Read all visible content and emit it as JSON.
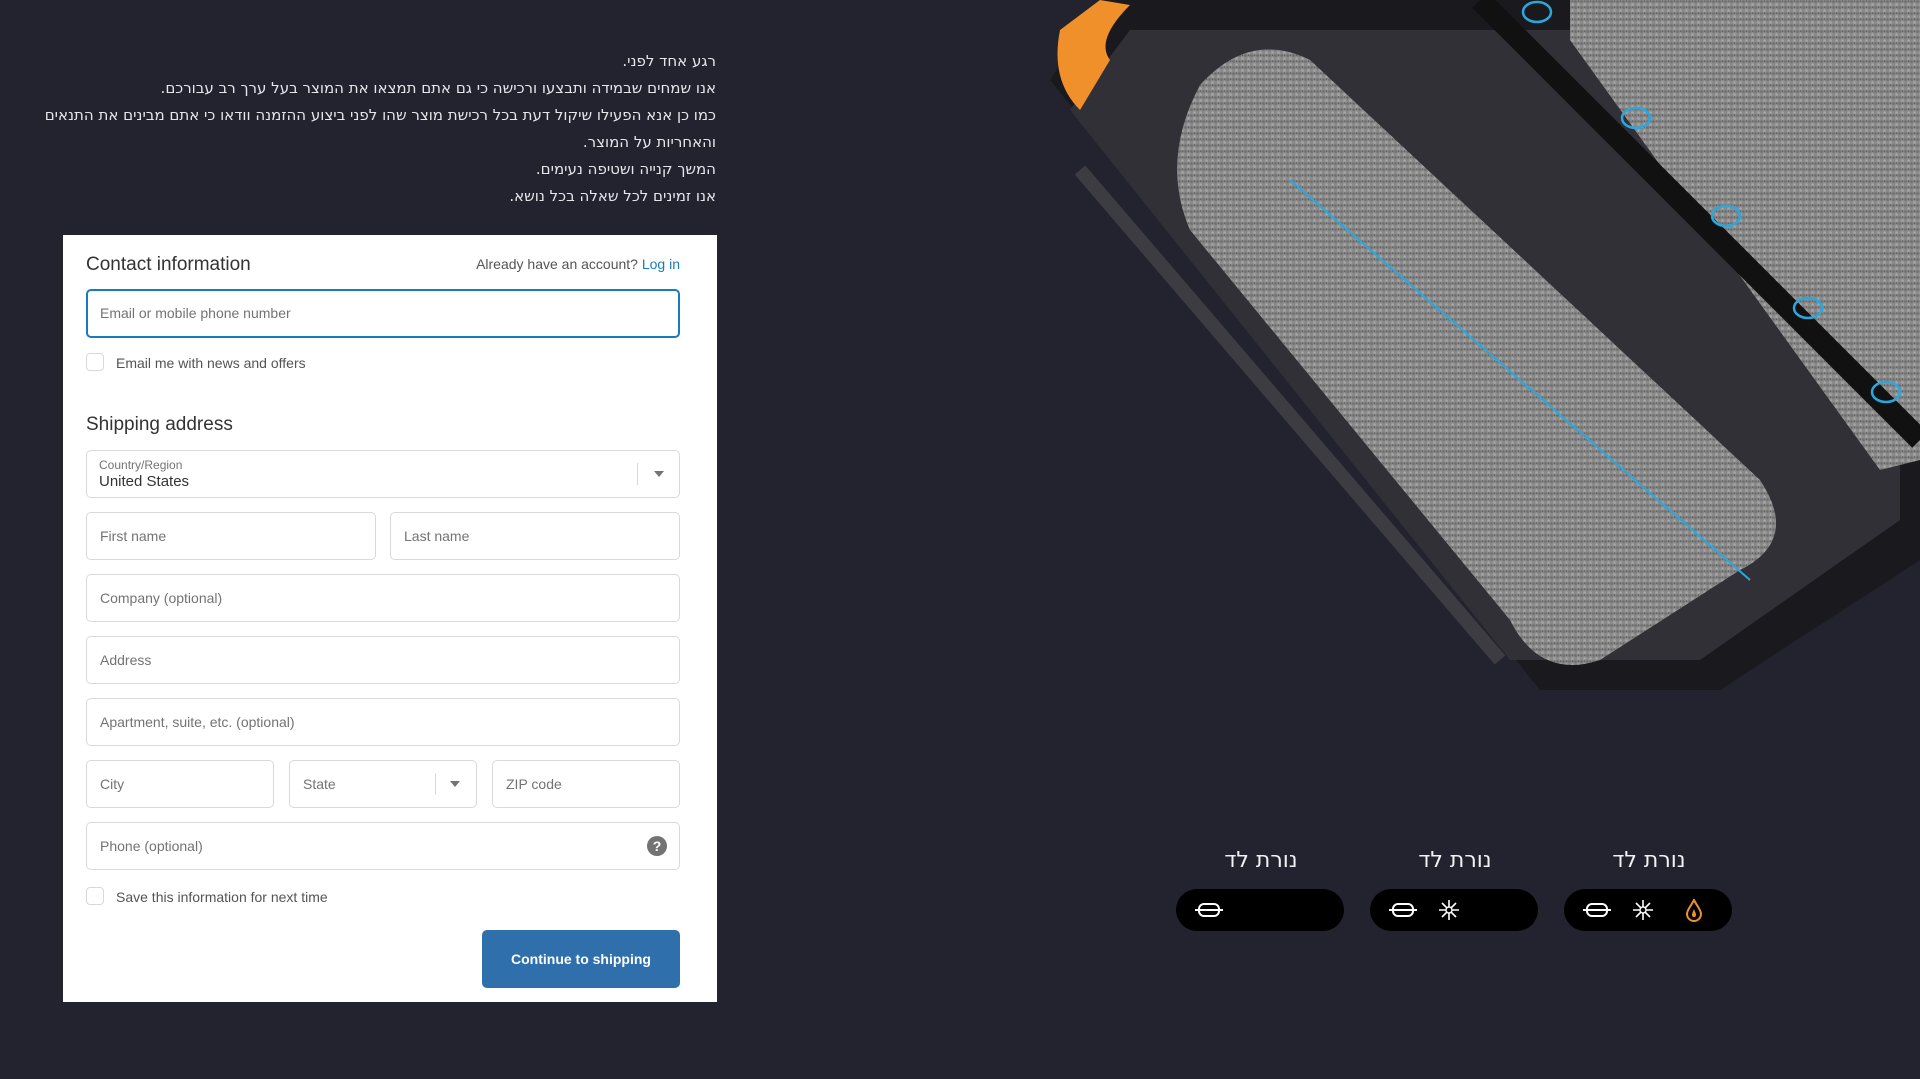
{
  "notice_lines": [
    "רגע אחד לפני.",
    "אנו שמחים שבמידה ותבצעו ורכישה כי גם אתם תמצאו את המוצר בעל ערך רב עבורכם.",
    "כמו כן אנא הפעילו שיקול דעת בכל רכישת מוצר שהו לפני ביצוע ההזמנה וודאו כי אתם מבינים את התנאים",
    "והאחריות על המוצר.",
    "המשך קנייה ושטיפה נעימים.",
    "אנו זמינים לכל שאלה בכל נושא."
  ],
  "contact": {
    "title": "Contact information",
    "account_prompt": "Already have an account?",
    "login_label": "Log in",
    "email_placeholder": "Email or mobile phone number",
    "email_value": "",
    "news_checkbox_label": "Email me with news and offers",
    "news_checked": false
  },
  "shipping": {
    "title": "Shipping address",
    "country_label": "Country/Region",
    "country_value": "United States",
    "first_name_placeholder": "First name",
    "last_name_placeholder": "Last name",
    "company_placeholder": "Company (optional)",
    "address_placeholder": "Address",
    "apartment_placeholder": "Apartment, suite, etc. (optional)",
    "city_placeholder": "City",
    "state_placeholder": "State",
    "zip_placeholder": "ZIP code",
    "phone_placeholder": "Phone (optional)",
    "help_glyph": "?",
    "save_checkbox_label": "Save this information for next time",
    "save_checked": false,
    "continue_label": "Continue to shipping"
  },
  "led_modes": [
    {
      "title": "נורת לד",
      "icons": [
        "roller-icon"
      ]
    },
    {
      "title": "נורת לד",
      "icons": [
        "roller-icon",
        "sparkle-icon"
      ]
    },
    {
      "title": "נורת לד",
      "icons": [
        "roller-icon",
        "sparkle-icon",
        "water-drop-icon"
      ]
    }
  ],
  "colors": {
    "background": "#23222f",
    "accent_blue": "#197bbd",
    "button_blue": "#2f6fab",
    "highlight_cyan": "#29a8e0",
    "accent_orange": "#f0902a"
  }
}
